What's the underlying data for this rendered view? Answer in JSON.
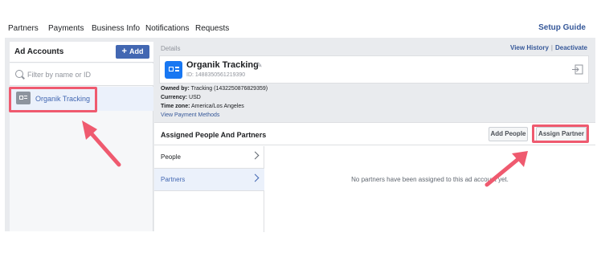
{
  "nav": {
    "tabs": [
      "Partners",
      "Payments",
      "Business Info",
      "Notifications",
      "Requests"
    ],
    "setup_guide": "Setup Guide"
  },
  "sidebar": {
    "title": "Ad Accounts",
    "add_label": "Add",
    "filter_placeholder": "Filter by name or ID",
    "items": [
      {
        "label": "Organik Tracking",
        "selected": true
      }
    ]
  },
  "details": {
    "label": "Details",
    "view_history": "View History",
    "separator": "|",
    "deactivate": "Deactivate",
    "account_name": "Organik Tracking",
    "account_id": "ID: 1488350561219390",
    "owned_by_label": "Owned by:",
    "owned_by": "Tracking (1432250876829359)",
    "currency_label": "Currency:",
    "currency": "USD",
    "timezone_label": "Time zone:",
    "timezone": "America/Los Angeles",
    "payment_link": "View Payment Methods"
  },
  "assigned": {
    "title": "Assigned People And Partners",
    "add_people": "Add People",
    "assign_partner": "Assign Partner",
    "tabs": [
      {
        "label": "People",
        "active": false
      },
      {
        "label": "Partners",
        "active": true
      }
    ],
    "empty_message": "No partners have been assigned to this ad account yet."
  },
  "colors": {
    "brand": "#4267b2",
    "link": "#365899",
    "annotation": "#ef5a6f"
  }
}
